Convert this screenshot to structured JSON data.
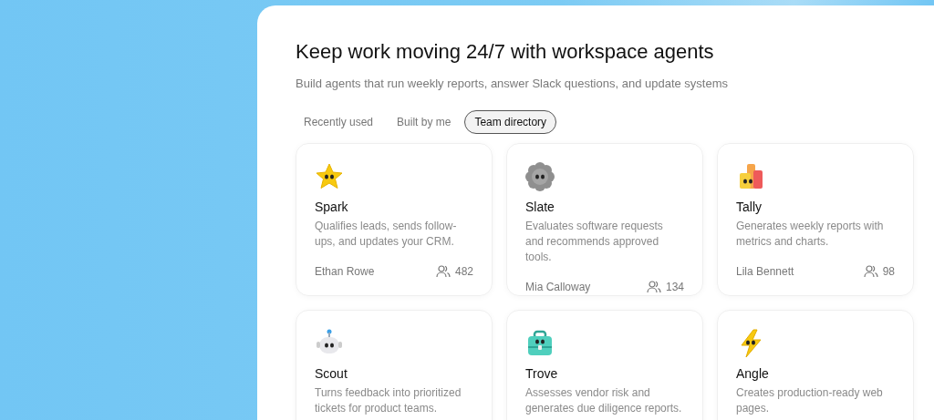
{
  "header": {
    "title": "Keep work moving 24/7 with workspace agents",
    "subtitle": "Build agents that run weekly reports, answer Slack questions, and update systems"
  },
  "tabs": [
    {
      "label": "Recently used",
      "selected": false
    },
    {
      "label": "Built by me",
      "selected": false
    },
    {
      "label": "Team directory",
      "selected": true
    }
  ],
  "agents": [
    {
      "name": "Spark",
      "description": "Qualifies leads, sends follow-ups, and updates your CRM.",
      "owner": "Ethan Rowe",
      "users": "482"
    },
    {
      "name": "Slate",
      "description": "Evaluates software requests and recommends approved tools.",
      "owner": "Mia Calloway",
      "users": "134"
    },
    {
      "name": "Tally",
      "description": "Generates weekly reports with metrics and charts.",
      "owner": "Lila Bennett",
      "users": "98"
    },
    {
      "name": "Scout",
      "description": "Turns feedback into prioritized tickets for product teams."
    },
    {
      "name": "Trove",
      "description": "Assesses vendor risk and generates due diligence reports."
    },
    {
      "name": "Angle",
      "description": "Creates production-ready web pages."
    }
  ]
}
